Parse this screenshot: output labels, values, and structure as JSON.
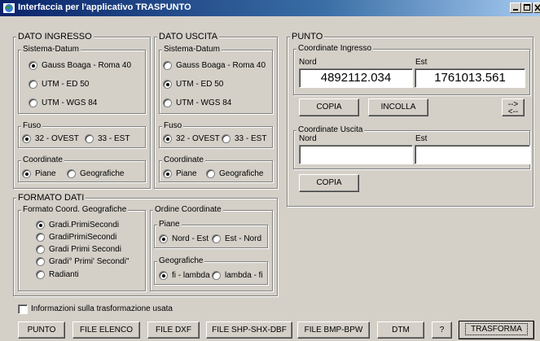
{
  "window": {
    "title": "Interfaccia per l'applicativo TRASPUNTO"
  },
  "dato_ingresso": {
    "legend": "DATO INGRESSO",
    "sistema_datum": {
      "legend": "Sistema-Datum",
      "options": [
        "Gauss Boaga - Roma 40",
        "UTM - ED 50",
        "UTM - WGS 84"
      ],
      "selected": "Gauss Boaga - Roma 40"
    },
    "fuso": {
      "legend": "Fuso",
      "options": [
        "32 - OVEST",
        "33 - EST"
      ],
      "selected": "32 - OVEST"
    },
    "coordinate": {
      "legend": "Coordinate",
      "options": [
        "Piane",
        "Geografiche"
      ],
      "selected": "Piane"
    }
  },
  "dato_uscita": {
    "legend": "DATO USCITA",
    "sistema_datum": {
      "legend": "Sistema-Datum",
      "options": [
        "Gauss Boaga - Roma 40",
        "UTM - ED 50",
        "UTM - WGS 84"
      ],
      "selected": "UTM - ED 50"
    },
    "fuso": {
      "legend": "Fuso",
      "options": [
        "32 - OVEST",
        "33 - EST"
      ],
      "selected": "32 - OVEST"
    },
    "coordinate": {
      "legend": "Coordinate",
      "options": [
        "Piane",
        "Geografiche"
      ],
      "selected": "Piane"
    }
  },
  "formato_dati": {
    "legend": "FORMATO DATI",
    "formato_geo": {
      "legend": "Formato Coord. Geografiche",
      "options": [
        "Gradi.PrimiSecondi",
        "GradiPrimiSecondi",
        "Gradi Primi Secondi",
        "Gradi° Primi' Secondi\"",
        "Radianti"
      ],
      "selected": "Gradi.PrimiSecondi"
    },
    "ordine": {
      "legend": "Ordine Coordinate",
      "piane": {
        "legend": "Piane",
        "options": [
          "Nord - Est",
          "Est - Nord"
        ],
        "selected": "Nord - Est"
      },
      "geografiche": {
        "legend": "Geografiche",
        "options": [
          "fi - lambda",
          "lambda - fi"
        ],
        "selected": "fi - lambda"
      }
    }
  },
  "punto": {
    "legend": "PUNTO",
    "ingresso": {
      "legend": "Coordinate Ingresso",
      "nord_label": "Nord",
      "est_label": "Est",
      "nord_value": "4892112.034",
      "est_value": "1761013.561"
    },
    "copia_label": "COPIA",
    "incolla_label": "INCOLLA",
    "swap_top": "-->",
    "swap_bottom": "<--",
    "uscita": {
      "legend": "Coordinate Uscita",
      "nord_label": "Nord",
      "est_label": "Est",
      "nord_value": "",
      "est_value": ""
    },
    "copia2_label": "COPIA"
  },
  "info_checkbox": {
    "label": "Informazioni sulla trasformazione usata",
    "checked": false
  },
  "bottom_buttons": {
    "punto": "PUNTO",
    "file_elenco": "FILE ELENCO",
    "file_dxf": "FILE DXF",
    "file_shp": "FILE SHP-SHX-DBF",
    "file_bmp": "FILE BMP-BPW",
    "dtm": "DTM",
    "help": "?",
    "trasforma": "TRASFORMA"
  },
  "icons": {
    "app": "globe-icon",
    "minimize": "minimize-icon",
    "maximize": "maximize-icon",
    "close": "close-icon"
  }
}
